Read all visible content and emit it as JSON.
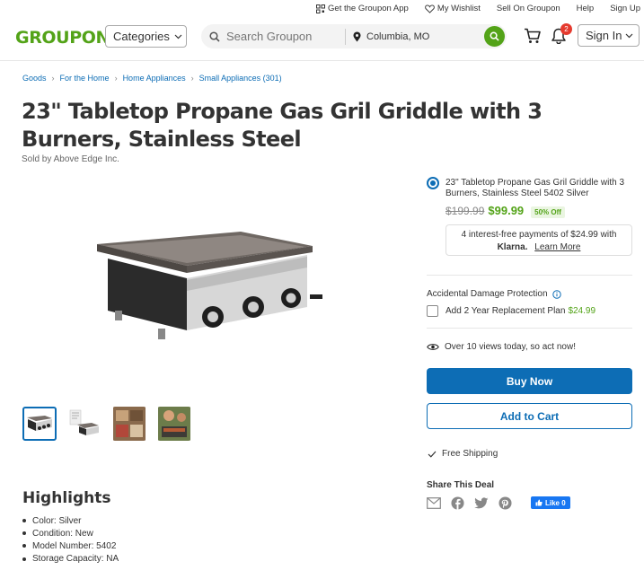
{
  "utility": {
    "app": "Get the Groupon App",
    "wishlist": "My Wishlist",
    "sell": "Sell On Groupon",
    "help": "Help",
    "signup": "Sign Up"
  },
  "header": {
    "logo": "GROUPON",
    "categories": "Categories",
    "search_placeholder": "Search Groupon",
    "location": "Columbia, MO",
    "notif_count": "2",
    "signin": "Sign In"
  },
  "breadcrumb": [
    "Goods",
    "For the Home",
    "Home Appliances",
    "Small Appliances (301)"
  ],
  "product": {
    "title": "23\" Tabletop Propane Gas Gril Griddle with 3 Burners, Stainless Steel",
    "sold_by": "Sold by Above Edge Inc.",
    "option_label": "23\" Tabletop Propane Gas Gril Griddle with 3 Burners, Stainless Steel 5402 Silver",
    "old_price": "$199.99",
    "price": "$99.99",
    "discount": "50% Off",
    "klarna_text": "4 interest-free payments of $24.99 with",
    "klarna_logo": "Klarna.",
    "klarna_link": "Learn More"
  },
  "protection": {
    "title": "Accidental Damage Protection",
    "plan": "Add 2 Year Replacement Plan",
    "plan_price": "$24.99"
  },
  "views_text": "Over 10 views today, so act now!",
  "buy_now": "Buy Now",
  "add_to_cart": "Add to Cart",
  "free_shipping": "Free Shipping",
  "share_title": "Share This Deal",
  "fb_like": "Like 0",
  "highlights": {
    "title": "Highlights",
    "items": [
      "Color: Silver",
      "Condition: New",
      "Model Number: 5402",
      "Storage Capacity: NA"
    ]
  },
  "colors": {
    "brand_green": "#53a318",
    "link_blue": "#0d6db5"
  }
}
